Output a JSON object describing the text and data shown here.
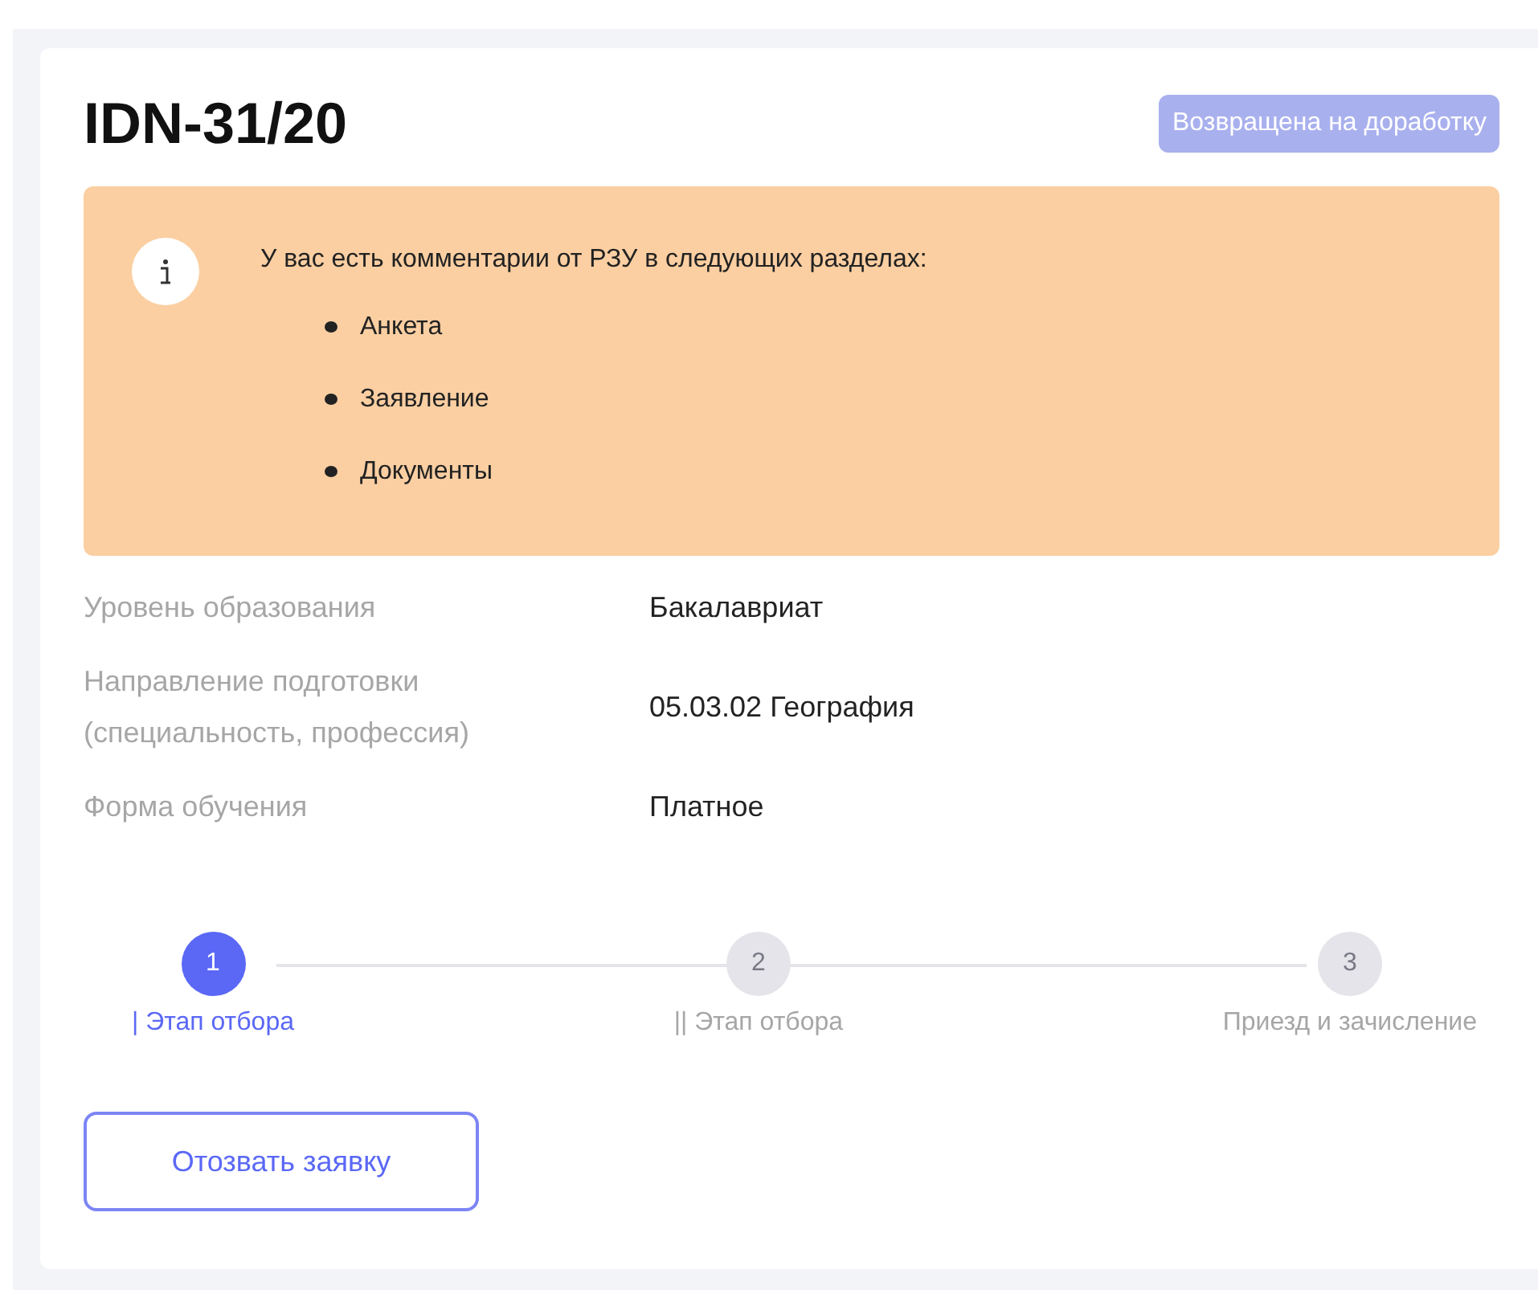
{
  "application": {
    "number": "IDN-31/20",
    "status": "Возвращена на доработку"
  },
  "notice": {
    "text": "У вас есть комментарии от РЗУ в следующих разделах:",
    "items": [
      "Анкета",
      "Заявление",
      "Документы"
    ]
  },
  "details": [
    {
      "label": "Уровень образования",
      "value": "Бакалавриат"
    },
    {
      "label": "Направление подготовки (специальность, профессия)",
      "value": "05.03.02 География"
    },
    {
      "label": "Форма обучения",
      "value": "Платное"
    }
  ],
  "steps": [
    {
      "number": "1",
      "label": "| Этап отбора",
      "selected": true
    },
    {
      "number": "2",
      "label": "|| Этап отбора",
      "selected": false
    },
    {
      "number": "3",
      "label": "Приезд и зачисление",
      "selected": false
    }
  ],
  "withdraw_button": "Отозвать заявку"
}
